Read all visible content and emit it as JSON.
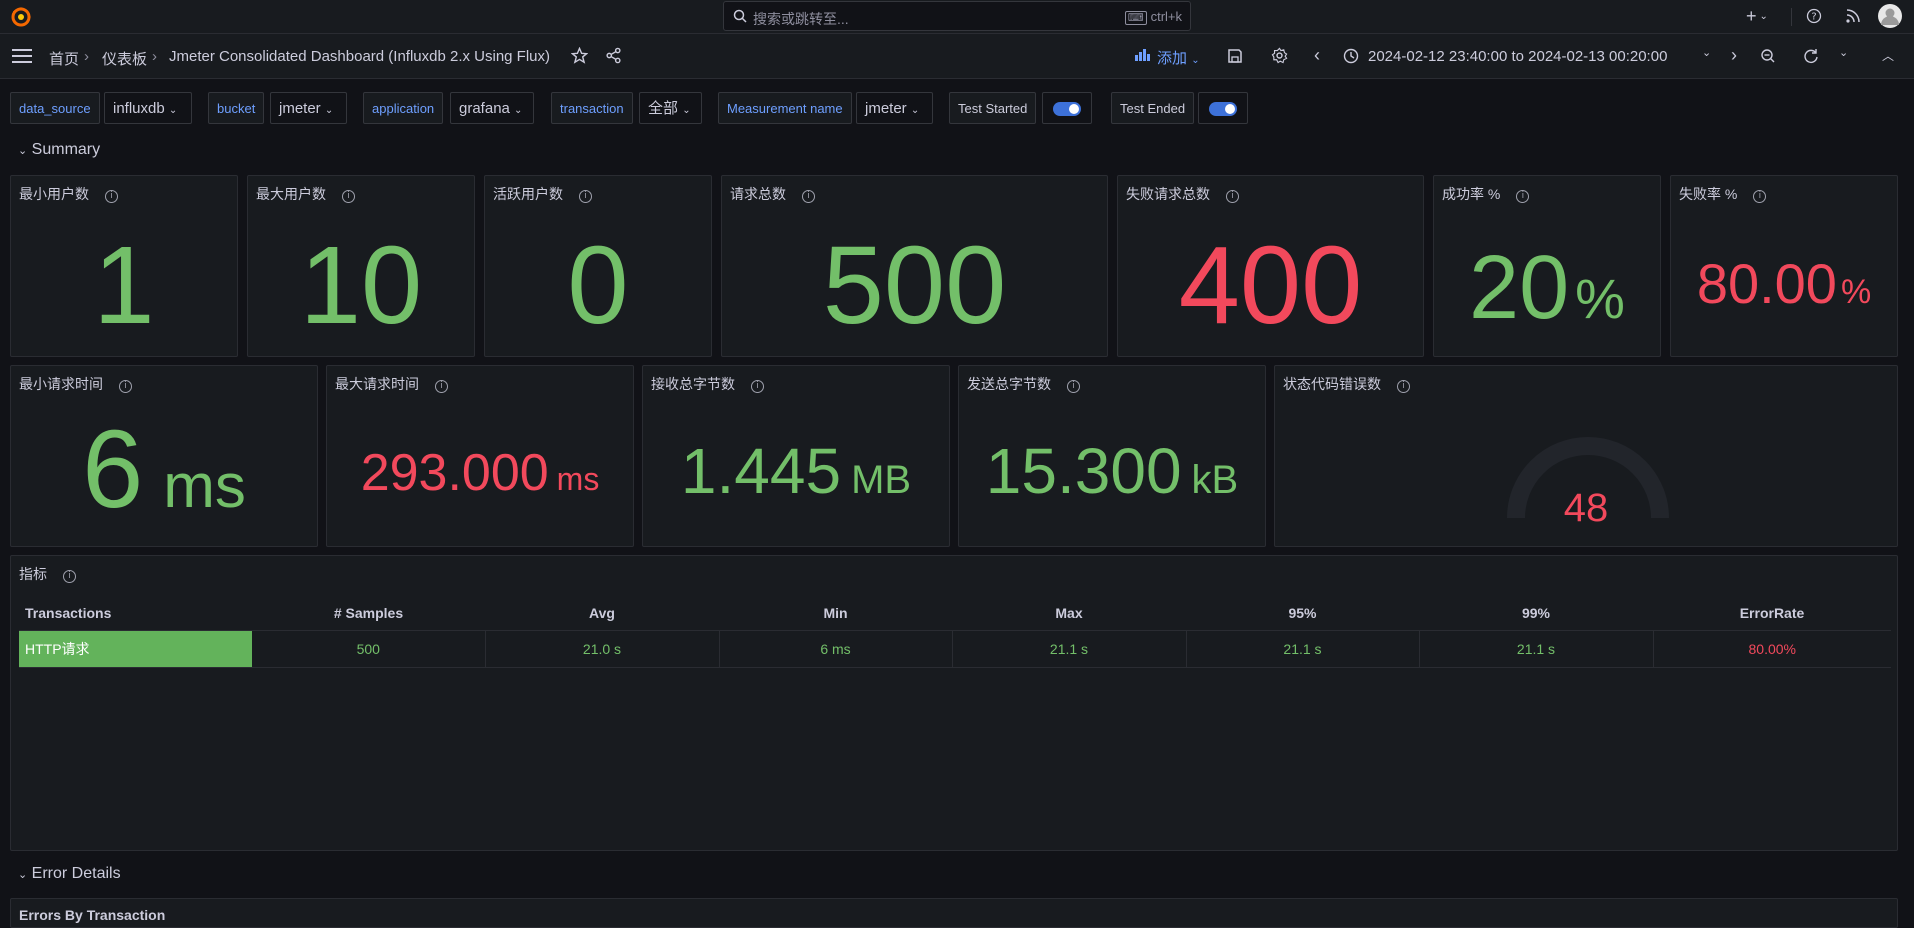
{
  "colors": {
    "accent": "#6e9fff",
    "ok": "#73bf69",
    "bad": "#f2495c",
    "bg": "#111217",
    "panel": "#181b1f"
  },
  "topbar": {
    "search_placeholder": "搜索或跳转至...",
    "search_shortcut": "ctrl+k",
    "icons": [
      "grafana-logo-icon",
      "plus-icon",
      "help-icon",
      "rss-icon",
      "user-avatar-icon"
    ]
  },
  "nav": {
    "breadcrumb": [
      "首页",
      "仪表板",
      "Jmeter Consolidated Dashboard (Influxdb 2.x Using Flux)"
    ],
    "add_label": "添加",
    "time_range": "2024-02-12 23:40:00 to 2024-02-13 00:20:00"
  },
  "variables": [
    {
      "label": "data_source",
      "value": "influxdb"
    },
    {
      "label": "bucket",
      "value": "jmeter"
    },
    {
      "label": "application",
      "value": "grafana"
    },
    {
      "label": "transaction",
      "value": "全部"
    },
    {
      "label": "Measurement name",
      "value": "jmeter"
    }
  ],
  "toggles": [
    {
      "label": "Test Started",
      "on": true
    },
    {
      "label": "Test Ended",
      "on": true
    }
  ],
  "sections": {
    "summary": "Summary",
    "error_details": "Error Details",
    "errors_by_transaction": "Errors By Transaction"
  },
  "stats_row1": [
    {
      "title": "最小用户数",
      "value": "1",
      "unit": "",
      "status": "ok"
    },
    {
      "title": "最大用户数",
      "value": "10",
      "unit": "",
      "status": "ok"
    },
    {
      "title": "活跃用户数",
      "value": "0",
      "unit": "",
      "status": "ok"
    },
    {
      "title": "请求总数",
      "value": "500",
      "unit": "",
      "status": "ok"
    },
    {
      "title": "失败请求总数",
      "value": "400",
      "unit": "",
      "status": "bad"
    },
    {
      "title": "成功率 %",
      "value": "20",
      "unit": "%",
      "status": "ok"
    },
    {
      "title": "失败率 %",
      "value": "80.00",
      "unit": "%",
      "status": "bad"
    }
  ],
  "stats_row2": [
    {
      "title": "最小请求时间",
      "value": "6",
      "unit": "ms",
      "status": "ok"
    },
    {
      "title": "最大请求时间",
      "value": "293.000",
      "unit": "ms",
      "status": "bad"
    },
    {
      "title": "接收总字节数",
      "value": "1.445",
      "unit": "MB",
      "status": "ok"
    },
    {
      "title": "发送总字节数",
      "value": "15.300",
      "unit": "kB",
      "status": "ok"
    }
  ],
  "gauge": {
    "title": "状态代码错误数",
    "value": "48",
    "status": "bad"
  },
  "metrics_table": {
    "title": "指标",
    "columns": [
      "Transactions",
      "# Samples",
      "Avg",
      "Min",
      "Max",
      "95%",
      "99%",
      "ErrorRate"
    ],
    "rows": [
      [
        "HTTP请求",
        "500",
        "21.0 s",
        "6 ms",
        "21.1 s",
        "21.1 s",
        "21.1 s",
        "80.00%"
      ]
    ]
  }
}
